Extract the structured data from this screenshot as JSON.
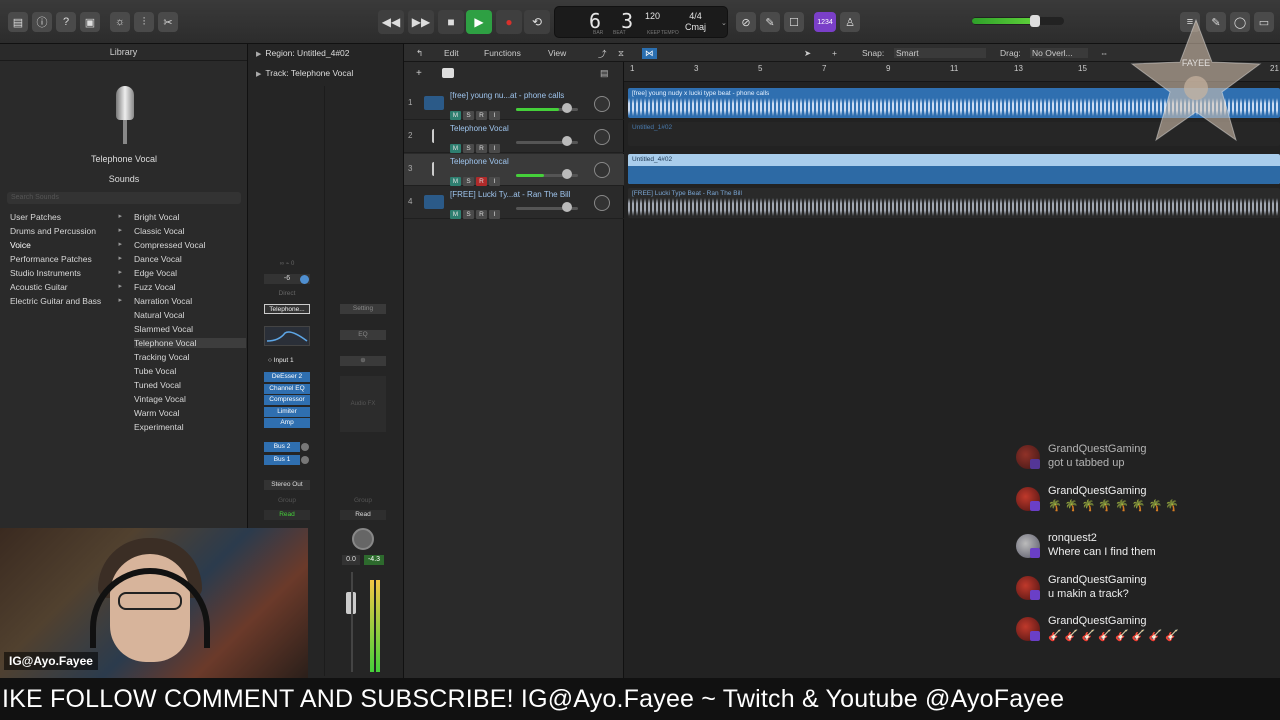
{
  "transport": {
    "position": "6 3",
    "position_sub_labels": [
      "BAR",
      "BEAT"
    ],
    "tempo": "120",
    "tempo_label": "KEEP",
    "time_signature": "4/4",
    "key": "Cmaj",
    "sig_label": "TEMPO",
    "badge": "1234",
    "master_volume": 0.7
  },
  "library": {
    "title": "Library",
    "patch_name": "Telephone Vocal",
    "sounds_label": "Sounds",
    "search_placeholder": "Search Sounds",
    "categories": [
      "User Patches",
      "Drums and Percussion",
      "Voice",
      "Performance Patches",
      "Studio Instruments",
      "Acoustic Guitar",
      "Electric Guitar and Bass"
    ],
    "selected_category": "Voice",
    "patches": [
      "Bright Vocal",
      "Classic Vocal",
      "Compressed Vocal",
      "Dance Vocal",
      "Edge Vocal",
      "Fuzz Vocal",
      "Narration Vocal",
      "Natural Vocal",
      "Slammed Vocal",
      "Telephone Vocal",
      "Tracking Vocal",
      "Tube Vocal",
      "Tuned Vocal",
      "Vintage Vocal",
      "Warm Vocal",
      "Experimental"
    ],
    "selected_patch": "Telephone Vocal"
  },
  "inspector": {
    "region_label": "Region: Untitled_4#02",
    "track_label": "Track: Telephone Vocal",
    "setting_name": "Telephone...",
    "input": "Input 1",
    "plugins": [
      "DeEsser 2",
      "Channel EQ",
      "Compressor",
      "Limiter",
      "Amp"
    ],
    "sends": [
      "Bus 2",
      "Bus 1"
    ],
    "output": "Stereo Out",
    "automation_left": "Read",
    "automation_right": "Read",
    "gain_value": "-6",
    "volume_value": "0.0",
    "peak_value": "-4.3",
    "setting_label_right": "Setting",
    "eq_label": "EQ",
    "audio_fx_label": "Audio FX",
    "direct_label": "Direct",
    "group_label": "Group"
  },
  "menubar": {
    "edit": "Edit",
    "functions": "Functions",
    "view": "View",
    "snap_label": "Snap:",
    "snap_value": "Smart",
    "drag_label": "Drag:",
    "drag_value": "No Overl..."
  },
  "ruler": [
    "1",
    "3",
    "5",
    "7",
    "9",
    "11",
    "13",
    "15",
    "21"
  ],
  "tracks": [
    {
      "num": "1",
      "name": "[free] young nu...at - phone calls",
      "m": "M",
      "s": "S",
      "r": "R",
      "i": "I",
      "level": 0.7
    },
    {
      "num": "2",
      "name": "Telephone Vocal",
      "m": "M",
      "s": "S",
      "r": "R",
      "i": "I",
      "level": 0.0
    },
    {
      "num": "3",
      "name": "Telephone Vocal",
      "m": "M",
      "s": "S",
      "r": "R",
      "i": "I",
      "level": 0.45
    },
    {
      "num": "4",
      "name": "[FREE] Lucki Ty...at - Ran The Bill",
      "m": "M",
      "s": "S",
      "r": "R",
      "i": "I",
      "level": 0.0
    }
  ],
  "regions": [
    {
      "label": "[free] young nudy x lucki type beat - phone calls"
    },
    {
      "label": "Untitled_1#02"
    },
    {
      "label": "Untitled_4#02"
    },
    {
      "label": "[FREE] Lucki Type Beat - Ran The Bill"
    }
  ],
  "chat": [
    {
      "user": "GrandQuestGaming",
      "text": "got u tabbed up",
      "faded": true
    },
    {
      "user": "GrandQuestGaming",
      "text": "🌴 🌴 🌴 🌴 🌴 🌴 🌴 🌴",
      "faded": false
    },
    {
      "user": "ronquest2",
      "text": "Where can I find them",
      "faded": false
    },
    {
      "user": "GrandQuestGaming",
      "text": "u makin a track?",
      "faded": false
    },
    {
      "user": "GrandQuestGaming",
      "text": "🎸 🎸 🎸 🎸 🎸 🎸 🎸 🎸",
      "faded": false
    }
  ],
  "webcam": {
    "tag": "IG@Ayo.Fayee"
  },
  "watermark": "FAYEE",
  "ticker": "IKE FOLLOW COMMENT AND SUBSCRIBE! IG@Ayo.Fayee ~ Twitch & Youtube @AyoFayee",
  "colors": {
    "region_blue": "#2f6fb0",
    "region_selected": "#a9cdec",
    "accent_green": "#45d03a",
    "record_red": "#d9302b",
    "play_green": "#2ea043"
  }
}
